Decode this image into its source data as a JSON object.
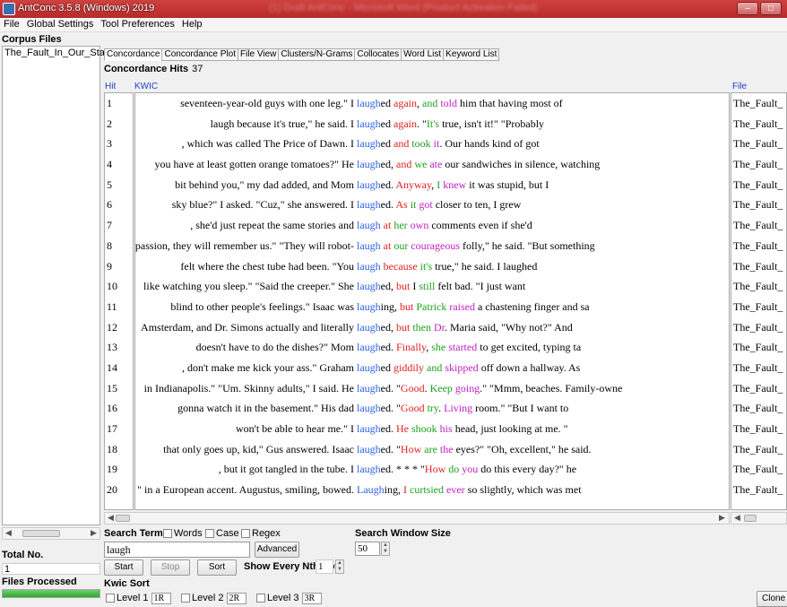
{
  "window": {
    "title": "AntConc 3.5.8 (Windows) 2019",
    "blurred_title": "(1) Draft AntConc - Microsoft Word (Product Activation Failed)"
  },
  "menu": [
    "File",
    "Global Settings",
    "Tool Preferences",
    "Help"
  ],
  "sidebar": {
    "header": "Corpus Files",
    "files": [
      "The_Fault_In_Our_Stars"
    ],
    "total_no_label": "Total No.",
    "total_no_value": "1",
    "files_processed_label": "Files Processed",
    "files_processed_fraction": 1.0
  },
  "tabs": [
    "Concordance",
    "Concordance Plot",
    "File View",
    "Clusters/N-Grams",
    "Collocates",
    "Word List",
    "Keyword List"
  ],
  "concordance": {
    "hits_label": "Concordance Hits",
    "hits_count": "37",
    "col_hit": "Hit",
    "col_kwic": "KWIC",
    "col_file": "File",
    "rows": [
      {
        "hit": "1",
        "file": "The_Fault_",
        "left": "seventeen-year-old guys with one leg.\" I",
        "right": [
          [
            "laugh",
            "kw"
          ],
          [
            "ed ",
            ""
          ],
          [
            "again",
            "c1"
          ],
          [
            ", ",
            ""
          ],
          [
            "and",
            "c2"
          ],
          [
            " ",
            ""
          ],
          [
            "told",
            "c3"
          ],
          [
            " him that having most of",
            ""
          ]
        ]
      },
      {
        "hit": "2",
        "file": "The_Fault_",
        "left": "laugh because it's true,\" he said. I",
        "right": [
          [
            "laugh",
            "kw"
          ],
          [
            "ed ",
            ""
          ],
          [
            "again",
            "c1"
          ],
          [
            ". \"",
            ""
          ],
          [
            "It's",
            "c2"
          ],
          [
            " true, isn't it!\" \"Probably",
            ""
          ]
        ]
      },
      {
        "hit": "3",
        "file": "The_Fault_",
        "left": ", which was called The Price of Dawn. I",
        "right": [
          [
            "laugh",
            "kw"
          ],
          [
            "ed ",
            ""
          ],
          [
            "and",
            "c1"
          ],
          [
            " ",
            ""
          ],
          [
            "took",
            "c2"
          ],
          [
            " ",
            ""
          ],
          [
            "it",
            "c3"
          ],
          [
            ". Our hands kind of got",
            ""
          ]
        ]
      },
      {
        "hit": "4",
        "file": "The_Fault_",
        "left": "you have at least gotten orange tomatoes?\" He",
        "right": [
          [
            "laugh",
            "kw"
          ],
          [
            "ed, ",
            ""
          ],
          [
            "and",
            "c1"
          ],
          [
            " ",
            ""
          ],
          [
            "we",
            "c2"
          ],
          [
            " ",
            ""
          ],
          [
            "ate",
            "c3"
          ],
          [
            " our sandwiches in silence, watching",
            ""
          ]
        ]
      },
      {
        "hit": "5",
        "file": "The_Fault_",
        "left": "bit behind you,\" my dad added, and Mom",
        "right": [
          [
            "laugh",
            "kw"
          ],
          [
            "ed. ",
            ""
          ],
          [
            "Anyway",
            "c1"
          ],
          [
            ", ",
            ""
          ],
          [
            "I",
            "c2"
          ],
          [
            " ",
            ""
          ],
          [
            "knew",
            "c3"
          ],
          [
            " it was stupid, but I",
            ""
          ]
        ]
      },
      {
        "hit": "6",
        "file": "The_Fault_",
        "left": "sky blue?\" I asked. \"Cuz,\" she answered. I",
        "right": [
          [
            "laugh",
            "kw"
          ],
          [
            "ed. ",
            ""
          ],
          [
            "As",
            "c1"
          ],
          [
            " ",
            ""
          ],
          [
            "it",
            "c2"
          ],
          [
            " ",
            ""
          ],
          [
            "got",
            "c3"
          ],
          [
            " closer to ten, I grew",
            ""
          ]
        ]
      },
      {
        "hit": "7",
        "file": "The_Fault_",
        "left": ", she'd just repeat the same stories and",
        "right": [
          [
            "laugh",
            "kw"
          ],
          [
            " ",
            ""
          ],
          [
            "at",
            "c1"
          ],
          [
            " ",
            ""
          ],
          [
            "her",
            "c2"
          ],
          [
            " ",
            ""
          ],
          [
            "own",
            "c3"
          ],
          [
            " comments even if she'd",
            ""
          ]
        ]
      },
      {
        "hit": "8",
        "file": "The_Fault_",
        "left": "passion, they will remember us.\" \"They will robot-",
        "right": [
          [
            "laugh",
            "kw"
          ],
          [
            " ",
            ""
          ],
          [
            "at",
            "c1"
          ],
          [
            " ",
            ""
          ],
          [
            "our",
            "c2"
          ],
          [
            " ",
            ""
          ],
          [
            "courageous",
            "c3"
          ],
          [
            " folly,\" he said. \"But something",
            ""
          ]
        ]
      },
      {
        "hit": "9",
        "file": "The_Fault_",
        "left": "felt where the chest tube had been. \"You",
        "right": [
          [
            "laugh",
            "kw"
          ],
          [
            " ",
            ""
          ],
          [
            "because",
            "c1"
          ],
          [
            " ",
            ""
          ],
          [
            "it's",
            "c2"
          ],
          [
            " true,\" he said. I laughed",
            ""
          ]
        ]
      },
      {
        "hit": "10",
        "file": "The_Fault_",
        "left": "like watching you sleep.\" \"Said the creeper.\" She",
        "right": [
          [
            "laugh",
            "kw"
          ],
          [
            "ed, ",
            ""
          ],
          [
            "but",
            "c1"
          ],
          [
            " I ",
            ""
          ],
          [
            "still",
            "c2"
          ],
          [
            " felt bad. \"I just want",
            ""
          ]
        ]
      },
      {
        "hit": "11",
        "file": "The_Fault_",
        "left": "blind to other people's feelings.\" Isaac was",
        "right": [
          [
            "laugh",
            "kw"
          ],
          [
            "ing, ",
            ""
          ],
          [
            "but",
            "c1"
          ],
          [
            " ",
            ""
          ],
          [
            "Patrick",
            "c2"
          ],
          [
            " ",
            ""
          ],
          [
            "raised",
            "c3"
          ],
          [
            " a chastening finger and sa",
            ""
          ]
        ]
      },
      {
        "hit": "12",
        "file": "The_Fault_",
        "left": "Amsterdam, and Dr. Simons actually and literally",
        "right": [
          [
            "laugh",
            "kw"
          ],
          [
            "ed, ",
            ""
          ],
          [
            "but",
            "c1"
          ],
          [
            " ",
            ""
          ],
          [
            "then",
            "c2"
          ],
          [
            " ",
            ""
          ],
          [
            "Dr",
            "c3"
          ],
          [
            ". Maria said, \"Why not?\" And",
            ""
          ]
        ]
      },
      {
        "hit": "13",
        "file": "The_Fault_",
        "left": "doesn't have to do the dishes?\" Mom",
        "right": [
          [
            "laugh",
            "kw"
          ],
          [
            "ed. ",
            ""
          ],
          [
            "Finally",
            "c1"
          ],
          [
            ", ",
            ""
          ],
          [
            "she",
            "c2"
          ],
          [
            " ",
            ""
          ],
          [
            "started",
            "c3"
          ],
          [
            " to get excited, typing ta",
            ""
          ]
        ]
      },
      {
        "hit": "14",
        "file": "The_Fault_",
        "left": ", don't make me kick your ass.\" Graham",
        "right": [
          [
            "laugh",
            "kw"
          ],
          [
            "ed ",
            ""
          ],
          [
            "giddily",
            "c1"
          ],
          [
            " ",
            ""
          ],
          [
            "and",
            "c2"
          ],
          [
            " ",
            ""
          ],
          [
            "skipped",
            "c3"
          ],
          [
            " off down a hallway. As",
            ""
          ]
        ]
      },
      {
        "hit": "15",
        "file": "The_Fault_",
        "left": "in Indianapolis.\" \"Um. Skinny adults,\" I said. He",
        "right": [
          [
            "laugh",
            "kw"
          ],
          [
            "ed. \"",
            ""
          ],
          [
            "Good",
            "c1"
          ],
          [
            ". ",
            ""
          ],
          [
            "Keep",
            "c2"
          ],
          [
            " ",
            ""
          ],
          [
            "going",
            "c3"
          ],
          [
            ".\" \"Mmm, beaches. Family-owne",
            ""
          ]
        ]
      },
      {
        "hit": "16",
        "file": "The_Fault_",
        "left": "gonna watch it in the basement.\" His dad",
        "right": [
          [
            "laugh",
            "kw"
          ],
          [
            "ed. \"",
            ""
          ],
          [
            "Good",
            "c1"
          ],
          [
            " ",
            ""
          ],
          [
            "try",
            "c2"
          ],
          [
            ". ",
            ""
          ],
          [
            "Living",
            "c3"
          ],
          [
            " room.\" \"But I want to",
            ""
          ]
        ]
      },
      {
        "hit": "17",
        "file": "The_Fault_",
        "left": "won't be able to hear me.\" I",
        "right": [
          [
            "laugh",
            "kw"
          ],
          [
            "ed. ",
            ""
          ],
          [
            "He",
            "c1"
          ],
          [
            " ",
            ""
          ],
          [
            "shook",
            "c2"
          ],
          [
            " ",
            ""
          ],
          [
            "his",
            "c3"
          ],
          [
            " head, just looking at me. \"",
            ""
          ]
        ]
      },
      {
        "hit": "18",
        "file": "The_Fault_",
        "left": "that only goes up, kid,\" Gus answered. Isaac",
        "right": [
          [
            "laugh",
            "kw"
          ],
          [
            "ed. \"",
            ""
          ],
          [
            "How",
            "c1"
          ],
          [
            " ",
            ""
          ],
          [
            "are",
            "c2"
          ],
          [
            " ",
            ""
          ],
          [
            "the",
            "c3"
          ],
          [
            " eyes?\" \"Oh, excellent,\" he said.",
            ""
          ]
        ]
      },
      {
        "hit": "19",
        "file": "The_Fault_",
        "left": ", but it got tangled in the tube. I",
        "right": [
          [
            "laugh",
            "kw"
          ],
          [
            "ed. * * *  \"",
            ""
          ],
          [
            "How",
            "c1"
          ],
          [
            " ",
            ""
          ],
          [
            "do",
            "c2"
          ],
          [
            " ",
            ""
          ],
          [
            "you",
            "c3"
          ],
          [
            " do this every day?\" he",
            ""
          ]
        ]
      },
      {
        "hit": "20",
        "file": "The_Fault_",
        "left": "\" in a European accent. Augustus, smiling, bowed.",
        "right": [
          [
            "Laugh",
            "kw"
          ],
          [
            "ing, ",
            ""
          ],
          [
            "I",
            "c1"
          ],
          [
            " ",
            ""
          ],
          [
            "curtsied",
            "c2"
          ],
          [
            " ",
            ""
          ],
          [
            "ever",
            "c3"
          ],
          [
            " so slightly, which was met",
            ""
          ]
        ]
      }
    ]
  },
  "controls": {
    "search_term_label": "Search Term",
    "words_label": "Words",
    "case_label": "Case",
    "regex_label": "Regex",
    "search_value": "laugh",
    "advanced_label": "Advanced",
    "window_size_label": "Search Window Size",
    "window_size_value": "50",
    "start_label": "Start",
    "stop_label": "Stop",
    "sort_label": "Sort",
    "nth_row_label": "Show Every Nth Row",
    "nth_row_value": "1",
    "kwic_sort_label": "Kwic Sort",
    "level1_label": "Level 1",
    "level1_value": "1R",
    "level2_label": "Level 2",
    "level2_value": "2R",
    "level3_label": "Level 3",
    "level3_value": "3R",
    "clone_label": "Clone Results"
  },
  "colors": {
    "keyword": "#2a5ee0",
    "position1": "#e02020",
    "position2": "#1ca01c",
    "position3": "#c020c0",
    "titlebar": "#c43535"
  }
}
